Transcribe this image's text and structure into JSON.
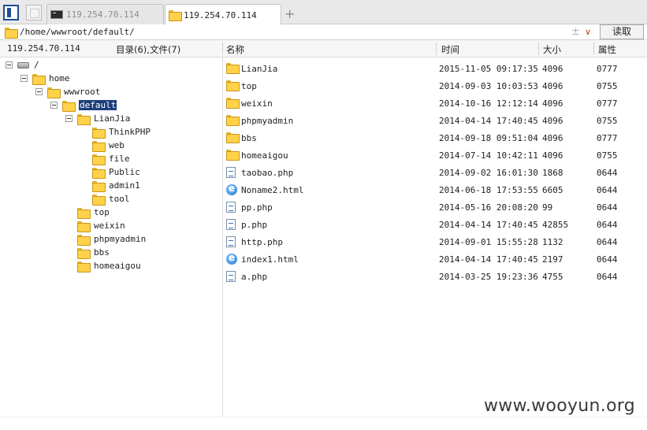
{
  "tabs": [
    {
      "label": "119.254.70.114",
      "active": false
    },
    {
      "label": "119.254.70.114",
      "active": true
    }
  ],
  "new_tab_label": "+",
  "path": {
    "value": "/home/wwwroot/default/",
    "add_glyph": "±",
    "dropdown_glyph": "∨",
    "read_button": "读取"
  },
  "header": {
    "host": "119.254.70.114",
    "summary": "目录(6),文件(7)",
    "col_name": "名称",
    "col_time": "时间",
    "col_size": "大小",
    "col_attr": "属性"
  },
  "tree": [
    {
      "label": "/",
      "icon": "drive-icon",
      "expandable": true,
      "depth": 0
    },
    {
      "label": "home",
      "icon": "folder-icon",
      "expandable": true,
      "depth": 1
    },
    {
      "label": "wwwroot",
      "icon": "folder-icon",
      "expandable": true,
      "depth": 2
    },
    {
      "label": "default",
      "icon": "folder-icon",
      "expandable": true,
      "depth": 3,
      "selected": true
    },
    {
      "label": "LianJia",
      "icon": "folder-icon",
      "expandable": true,
      "depth": 4
    },
    {
      "label": "ThinkPHP",
      "icon": "folder-icon",
      "expandable": false,
      "depth": 5
    },
    {
      "label": "web",
      "icon": "folder-icon",
      "expandable": false,
      "depth": 5
    },
    {
      "label": "file",
      "icon": "folder-icon",
      "expandable": false,
      "depth": 5
    },
    {
      "label": "Public",
      "icon": "folder-icon",
      "expandable": false,
      "depth": 5
    },
    {
      "label": "admin1",
      "icon": "folder-icon",
      "expandable": false,
      "depth": 5
    },
    {
      "label": "tool",
      "icon": "folder-icon",
      "expandable": false,
      "depth": 5
    },
    {
      "label": "top",
      "icon": "folder-icon",
      "expandable": false,
      "depth": 4
    },
    {
      "label": "weixin",
      "icon": "folder-icon",
      "expandable": false,
      "depth": 4
    },
    {
      "label": "phpmyadmin",
      "icon": "folder-icon",
      "expandable": false,
      "depth": 4
    },
    {
      "label": "bbs",
      "icon": "folder-icon",
      "expandable": false,
      "depth": 4
    },
    {
      "label": "homeaigou",
      "icon": "folder-icon",
      "expandable": false,
      "depth": 4
    }
  ],
  "files": [
    {
      "name": "LianJia",
      "time": "2015-11-05 09:17:35",
      "size": "4096",
      "attr": "0777",
      "icon": "folder-icon"
    },
    {
      "name": "top",
      "time": "2014-09-03 10:03:53",
      "size": "4096",
      "attr": "0755",
      "icon": "folder-icon"
    },
    {
      "name": "weixin",
      "time": "2014-10-16 12:12:14",
      "size": "4096",
      "attr": "0777",
      "icon": "folder-icon"
    },
    {
      "name": "phpmyadmin",
      "time": "2014-04-14 17:40:45",
      "size": "4096",
      "attr": "0755",
      "icon": "folder-icon"
    },
    {
      "name": "bbs",
      "time": "2014-09-18 09:51:04",
      "size": "4096",
      "attr": "0777",
      "icon": "folder-icon"
    },
    {
      "name": "homeaigou",
      "time": "2014-07-14 10:42:11",
      "size": "4096",
      "attr": "0755",
      "icon": "folder-icon"
    },
    {
      "name": "taobao.php",
      "time": "2014-09-02 16:01:30",
      "size": "1868",
      "attr": "0644",
      "icon": "php-file-icon"
    },
    {
      "name": "Noname2.html",
      "time": "2014-06-18 17:53:55",
      "size": "6605",
      "attr": "0644",
      "icon": "html-file-icon"
    },
    {
      "name": "pp.php",
      "time": "2014-05-16 20:08:20",
      "size": "99",
      "attr": "0644",
      "icon": "php-file-icon"
    },
    {
      "name": "p.php",
      "time": "2014-04-14 17:40:45",
      "size": "42855",
      "attr": "0644",
      "icon": "php-file-icon"
    },
    {
      "name": "http.php",
      "time": "2014-09-01 15:55:28",
      "size": "1132",
      "attr": "0644",
      "icon": "php-file-icon"
    },
    {
      "name": "index1.html",
      "time": "2014-04-14 17:40:45",
      "size": "2197",
      "attr": "0644",
      "icon": "html-file-icon"
    },
    {
      "name": "a.php",
      "time": "2014-03-25 19:23:36",
      "size": "4755",
      "attr": "0644",
      "icon": "php-file-icon"
    }
  ],
  "watermark": "www.wooyun.org",
  "colors": {
    "selection": "#1c3f7c",
    "folder": "#ffd24a",
    "active_frame": "#1e4f8f",
    "dropdown_accent": "#c0392b"
  }
}
